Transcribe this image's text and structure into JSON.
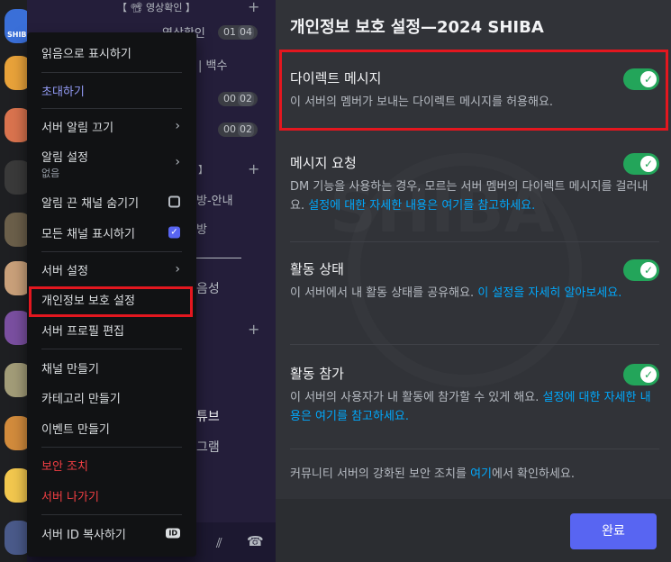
{
  "rail": {
    "colors": [
      "#3a6fd8",
      "#e8a23a",
      "#d9734e",
      "#3a3a3a",
      "#6b5f4a",
      "#c9a07a",
      "#7a4fa0",
      "#a29c78",
      "#d28b3c",
      "#f2c74e",
      "#4a5a8a"
    ],
    "shiba_label": "SHIB"
  },
  "channel_panel": {
    "category1": "【 📽 영상확인 】",
    "voice1": "영상확인",
    "voice1_counts": [
      "01",
      "04"
    ],
    "text2": "| 백수",
    "counts2": [
      "00",
      "02"
    ],
    "counts3": [
      "00",
      "02"
    ],
    "cat2": "】",
    "text_notice": "방-안내",
    "text_room": "방",
    "text_voice": "음성",
    "text_tube": "튜브",
    "text_gram": "그램"
  },
  "context_menu": {
    "mark_read": "읽음으로 표시하기",
    "invite": "초대하기",
    "mute_server": "서버 알림 끄기",
    "notif_settings": "알림 설정",
    "notif_sub": "없음",
    "hide_muted": "알림 끈 채널 숨기기",
    "show_all": "모든 채널 표시하기",
    "server_settings": "서버 설정",
    "privacy_settings": "개인정보 보호 설정",
    "edit_profile": "서버 프로필 편집",
    "create_channel": "채널 만들기",
    "create_category": "카테고리 만들기",
    "create_event": "이벤트 만들기",
    "security": "보안 조치",
    "leave_server": "서버 나가기",
    "copy_id": "서버 ID 복사하기",
    "id_badge": "ID"
  },
  "modal": {
    "title": "개인정보 보호 설정—2024 SHIBA",
    "watermark": "SHIBA",
    "dm": {
      "title": "다이렉트 메시지",
      "desc": "이 서버의 멤버가 보내는 다이렉트 메시지를 허용해요.",
      "enabled": true
    },
    "requests": {
      "title": "메시지 요청",
      "desc_prefix": "DM 기능을 사용하는 경우, 모르는 서버 멤버의 다이렉트 메시지를 걸러내요. ",
      "link": "설정에 대한 자세한 내용은 여기를 참고하세요.",
      "enabled": true
    },
    "activity": {
      "title": "활동 상태",
      "desc_prefix": "이 서버에서 내 활동 상태를 공유해요. ",
      "link": "이 설정을 자세히 알아보세요.",
      "enabled": true
    },
    "join": {
      "title": "활동 참가",
      "desc_prefix": "이 서버의 사용자가 내 활동에 참가할 수 있게 해요. ",
      "link": "설정에 대한 자세한 내용은 여기를 참고하세요.",
      "enabled": true
    },
    "community_prefix": "커뮤니티 서버의 강화된 보안 조치를 ",
    "community_link": "여기",
    "community_suffix": "에서 확인하세요.",
    "done": "완료"
  }
}
